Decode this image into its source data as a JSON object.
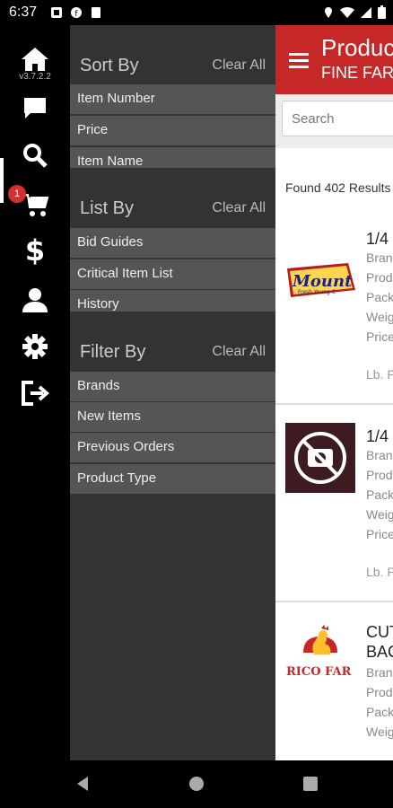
{
  "status_bar": {
    "time": "6:37"
  },
  "rail": {
    "version": "v3.7.2.2",
    "cart_badge": "1",
    "items": [
      "home-icon",
      "chat-icon",
      "search-icon",
      "cart-icon",
      "dollar-icon",
      "person-icon",
      "gear-icon",
      "logout-icon"
    ]
  },
  "drawer": {
    "sort": {
      "title": "Sort By",
      "clear": "Clear All",
      "options": [
        "Item Number",
        "Price",
        "Item Name"
      ]
    },
    "list": {
      "title": "List By",
      "clear": "Clear All",
      "options": [
        "Bid Guides",
        "Critical Item List",
        "History"
      ]
    },
    "filter": {
      "title": "Filter By",
      "clear": "Clear All",
      "options": [
        "Brands",
        "New Items",
        "Previous Orders",
        "Product Type"
      ]
    }
  },
  "header": {
    "title": "Products",
    "subtitle": "FINE FARMS"
  },
  "search": {
    "placeholder": "Search"
  },
  "results": {
    "found": "Found 402 Results"
  },
  "products": [
    {
      "name": "1/4",
      "fields": [
        "Brand",
        "Prod",
        "Pack",
        "Weig",
        "Price"
      ],
      "extra": "Lb. P",
      "logo_text": "Mount",
      "logo_sub": "Fresh Young C"
    },
    {
      "name": "1/4",
      "fields": [
        "Brand",
        "Prod",
        "Pack",
        "Weig",
        "Price"
      ],
      "extra": "Lb. P"
    },
    {
      "name": "CUT",
      "name2": "BAC",
      "fields": [
        "Brand",
        "Prod",
        "Pack",
        "Weig"
      ],
      "logo_text": "RICO FAR"
    }
  ],
  "colors": {
    "accent": "#c62828",
    "drawer": "#333333",
    "option": "#555555"
  }
}
